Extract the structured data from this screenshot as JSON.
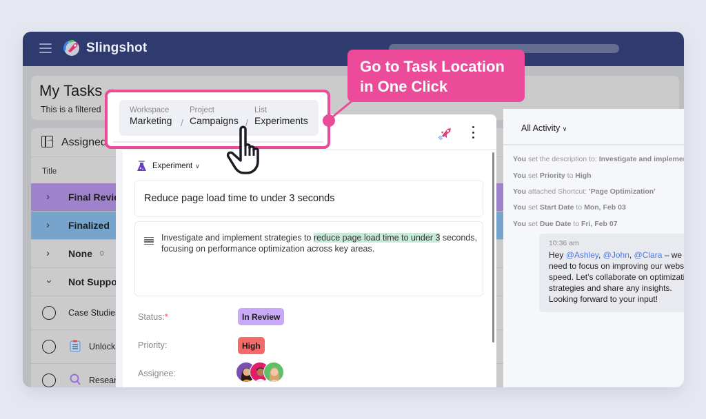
{
  "app": {
    "brand": "Slingshot",
    "brand_colors": {
      "topbar": "#2f3a6e",
      "accent": "#ec4b99"
    }
  },
  "my_tasks": {
    "title": "My Tasks",
    "subtitle": "This is a filtered"
  },
  "list": {
    "header_label": "Assigned",
    "column_title": "Title",
    "groups": [
      {
        "label": "Final Review",
        "color": "#9f82cc",
        "expanded": false
      },
      {
        "label": "Finalized",
        "color": "#77a4cc",
        "expanded": false
      },
      {
        "label": "None",
        "count": "0",
        "expanded": false
      },
      {
        "label": "Not Supported",
        "expanded": true
      }
    ],
    "tasks": [
      {
        "label": "Case Studies",
        "icon": "none"
      },
      {
        "label": "Unlock",
        "icon": "clipboard-icon"
      },
      {
        "label": "Research",
        "icon": "search-icon"
      }
    ]
  },
  "breadcrumb": {
    "segments": [
      {
        "caption": "Workspace",
        "value": "Marketing"
      },
      {
        "caption": "Project",
        "value": "Campaigns"
      },
      {
        "caption": "List",
        "value": "Experiments"
      }
    ],
    "separator": "/"
  },
  "tooltip": {
    "line1": "Go to Task Location",
    "line2": "in One Click"
  },
  "task": {
    "type": "Experiment",
    "title": "Reduce page load time to under 3 seconds",
    "description_before": "Investigate and implement strategies to ",
    "description_highlight": "reduce page load time to under 3",
    "description_after": " seconds, focusing on performance optimization across key areas.",
    "fields": {
      "status_label": "Status:",
      "status_required": "*",
      "status_value": "In Review",
      "status_color": "#c7a9f7",
      "priority_label": "Priority:",
      "priority_value": "High",
      "priority_color": "#f46a6a",
      "assignee_label": "Assignee:",
      "assignees": [
        "Ashley",
        "John",
        "Clara"
      ]
    }
  },
  "activity": {
    "filter_label": "All Activity",
    "entries": [
      {
        "actor": "You",
        "verb": " set the description to: ",
        "object": "Investigate and implement strategies"
      },
      {
        "actor": "You",
        "verb": " set ",
        "object": "Priority",
        "verb2": " to ",
        "object2": "High"
      },
      {
        "actor": "You",
        "verb": " attached Shortcut: ",
        "object": "'Page Optimization'"
      },
      {
        "actor": "You",
        "verb": " set ",
        "object": "Start Date",
        "verb2": " to ",
        "object2": "Mon, Feb 03"
      },
      {
        "actor": "You",
        "verb": " set ",
        "object": "Due Date",
        "verb2": " to ",
        "object2": "Fri, Feb 07"
      }
    ],
    "comment": {
      "time": "10:36 am",
      "greeting": "Hey ",
      "mentions": [
        "@Ashley",
        "@John",
        "@Clara"
      ],
      "body": " – we need to focus on improving our website speed. Let’s collaborate on optimization strategies and share any insights. Looking forward to your input!"
    }
  }
}
